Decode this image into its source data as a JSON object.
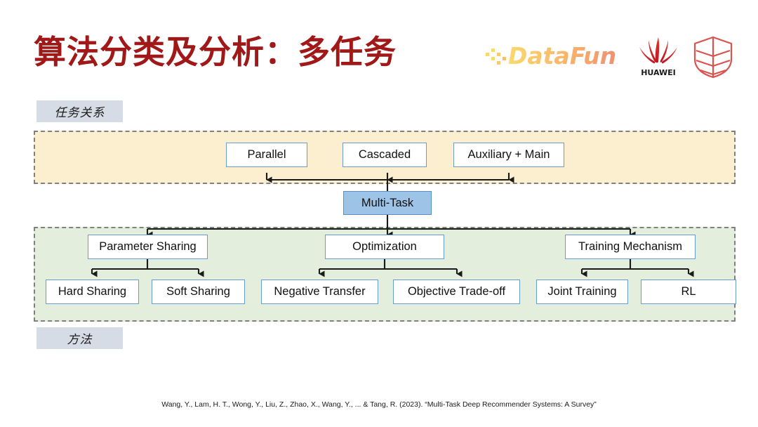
{
  "slide": {
    "title": "算法分类及分析：多任务",
    "title_color": "#A01818",
    "background": "#FFFFFF"
  },
  "logos": [
    {
      "name": "datafun-logo",
      "text": "DataFun.",
      "color": "#F6A96B"
    },
    {
      "name": "huawei-logo",
      "text": "HUAWEI",
      "color": "#E60012"
    },
    {
      "name": "shield-logo",
      "text": "",
      "color": "#D9534F"
    }
  ],
  "zones": {
    "top": {
      "label": "任务关系",
      "fill": "#FCEFD0",
      "border": "#808080"
    },
    "bottom": {
      "label": "方法",
      "fill": "#E4EEDC",
      "border": "#808080"
    }
  },
  "diagram": {
    "type": "tree",
    "root": {
      "id": "multitask",
      "label": "Multi-Task",
      "fill": "#9DC3E6",
      "border": "#5B8FC4"
    },
    "task_relations": [
      {
        "id": "parallel",
        "label": "Parallel"
      },
      {
        "id": "cascaded",
        "label": "Cascaded"
      },
      {
        "id": "auxmain",
        "label": "Auxiliary + Main"
      }
    ],
    "methods": [
      {
        "id": "paramshare",
        "label": "Parameter Sharing",
        "children": [
          {
            "id": "hardshare",
            "label": "Hard Sharing"
          },
          {
            "id": "softshare",
            "label": "Soft Sharing"
          }
        ]
      },
      {
        "id": "optimize",
        "label": "Optimization",
        "children": [
          {
            "id": "negtrans",
            "label": "Negative Transfer"
          },
          {
            "id": "objtrade",
            "label": "Objective Trade-off"
          }
        ]
      },
      {
        "id": "trainmech",
        "label": "Training Mechanism",
        "children": [
          {
            "id": "jointtrain",
            "label": "Joint Training"
          },
          {
            "id": "rl",
            "label": "RL"
          }
        ]
      }
    ],
    "node_fill": "#FFFFFF",
    "node_border": "#6A9BD1",
    "edge_color": "#1A1A1A"
  },
  "citation": "Wang, Y., Lam, H. T., Wong, Y., Liu, Z., Zhao, X., Wang, Y., ... & Tang, R. (2023). “Multi-Task Deep Recommender Systems: A Survey”"
}
